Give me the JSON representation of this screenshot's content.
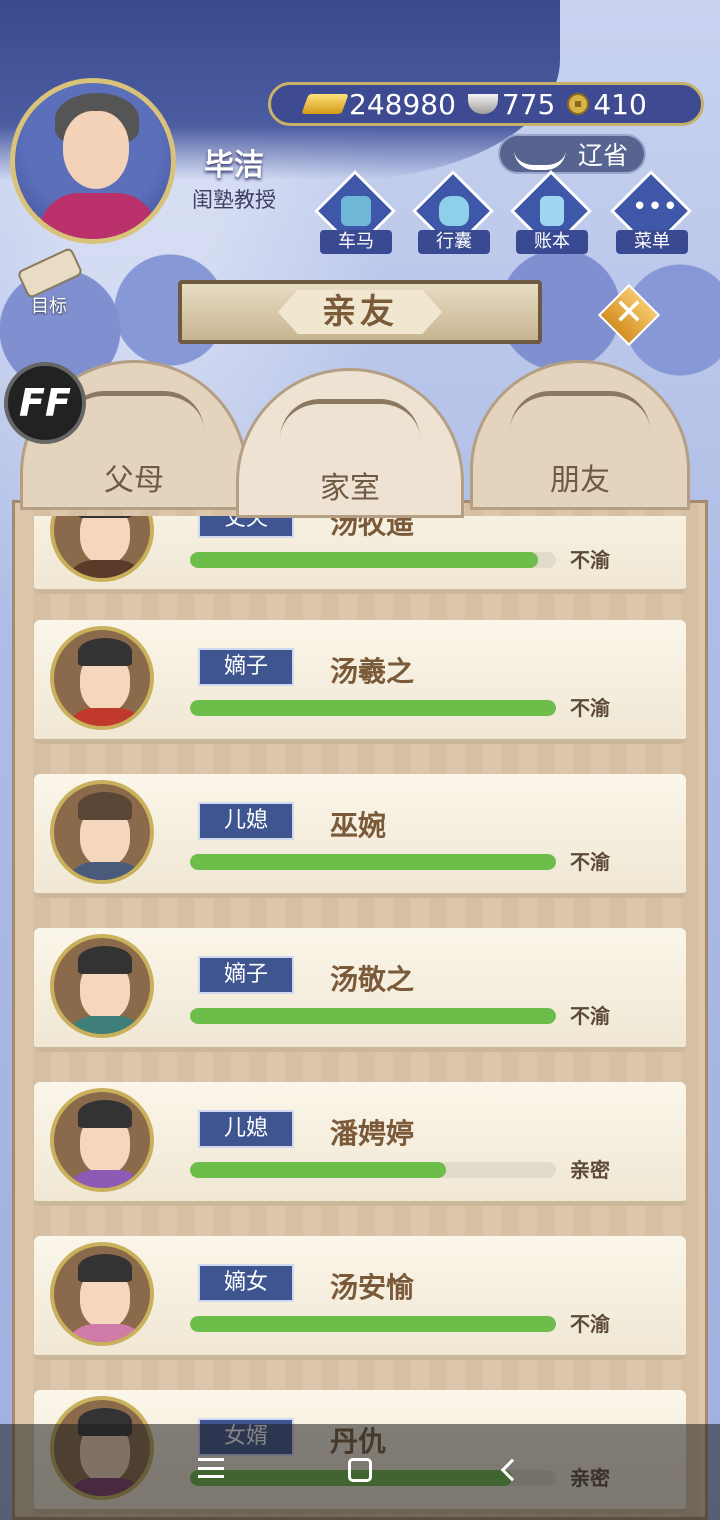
{
  "player": {
    "name": "毕洁",
    "title": "闺塾教授"
  },
  "currency": {
    "gold": "248980",
    "silver": "775",
    "coin": "410"
  },
  "location": "辽省",
  "menu": [
    {
      "label": "车马",
      "icon": "carriage-icon"
    },
    {
      "label": "行囊",
      "icon": "bag-icon"
    },
    {
      "label": "账本",
      "icon": "ledger-icon"
    },
    {
      "label": "菜单",
      "icon": "menu-dots-icon"
    }
  ],
  "target_label": "目标",
  "banner_title": "亲友",
  "ff_label": "FF",
  "tabs": [
    {
      "label": "父母"
    },
    {
      "label": "家室"
    },
    {
      "label": "朋友"
    }
  ],
  "family": [
    {
      "relation": "丈夫",
      "name": "汤牧遥",
      "status": "不渝",
      "affinity": 0.95
    },
    {
      "relation": "嫡子",
      "name": "汤羲之",
      "status": "不渝",
      "affinity": 1.0
    },
    {
      "relation": "儿媳",
      "name": "巫婉",
      "status": "不渝",
      "affinity": 1.0
    },
    {
      "relation": "嫡子",
      "name": "汤敬之",
      "status": "不渝",
      "affinity": 1.0
    },
    {
      "relation": "儿媳",
      "name": "潘娉婷",
      "status": "亲密",
      "affinity": 0.7
    },
    {
      "relation": "嫡女",
      "name": "汤安愉",
      "status": "不渝",
      "affinity": 1.0
    },
    {
      "relation": "女婿",
      "name": "丹仇",
      "status": "亲密",
      "affinity": 0.88
    }
  ],
  "colors": {
    "bar": "#6cbd4a",
    "relation_badge": "#3e5590"
  }
}
